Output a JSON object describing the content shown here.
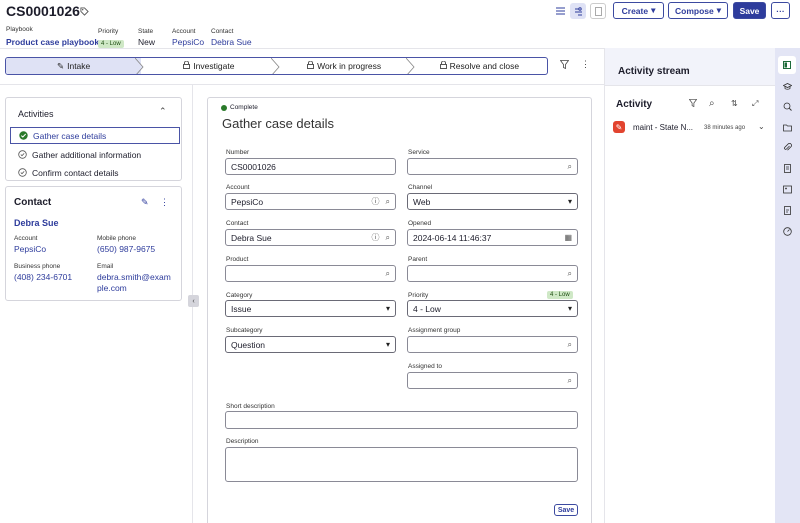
{
  "header": {
    "case_number": "CS0001026",
    "playbook_label": "Playbook",
    "playbook_value": "Product case playbook",
    "priority_label": "Priority",
    "priority_value": "4 - Low",
    "state_label": "State",
    "state_value": "New",
    "account_label": "Account",
    "account_value": "PepsiCo",
    "contact_label": "Contact",
    "contact_value": "Debra Sue",
    "create_label": "Create",
    "compose_label": "Compose",
    "save_label": "Save",
    "more_label": "···"
  },
  "stepper": {
    "steps": [
      {
        "label": "Intake",
        "icon": "pencil-icon"
      },
      {
        "label": "Investigate",
        "icon": "lock-icon"
      },
      {
        "label": "Work in progress",
        "icon": "lock-icon"
      },
      {
        "label": "Resolve and close",
        "icon": "lock-icon"
      }
    ]
  },
  "activities": {
    "title": "Activities",
    "items": [
      {
        "label": "Gather case details",
        "status": "complete"
      },
      {
        "label": "Gather additional information",
        "status": "pending"
      },
      {
        "label": "Confirm contact details",
        "status": "pending"
      }
    ]
  },
  "contact_card": {
    "title": "Contact",
    "name": "Debra Sue",
    "account_label": "Account",
    "account_value": "PepsiCo",
    "mobile_label": "Mobile phone",
    "mobile_value": "(650) 987-9675",
    "business_label": "Business phone",
    "business_value": "(408) 234-6701",
    "email_label": "Email",
    "email_line1": "debra.smith@exam",
    "email_line2": "ple.com"
  },
  "form": {
    "status": "Complete",
    "title": "Gather case details",
    "number_label": "Number",
    "number_value": "CS0001026",
    "service_label": "Service",
    "account_label": "Account",
    "account_value": "PepsiCo",
    "channel_label": "Channel",
    "channel_value": "Web",
    "contact_label": "Contact",
    "contact_value": "Debra Sue",
    "opened_label": "Opened",
    "opened_value": "2024-06-14 11:46:37",
    "product_label": "Product",
    "parent_label": "Parent",
    "category_label": "Category",
    "category_value": "Issue",
    "priority_label": "Priority",
    "priority_badge": "4 - Low",
    "priority_value": "4 - Low",
    "subcategory_label": "Subcategory",
    "subcategory_value": "Question",
    "assignment_group_label": "Assignment group",
    "assigned_to_label": "Assigned to",
    "short_description_label": "Short description",
    "description_label": "Description",
    "save_label": "Save"
  },
  "activity_stream": {
    "title": "Activity stream",
    "subtitle": "Activity",
    "entry_text": "maint - State N...",
    "entry_time": "38 minutes ago"
  },
  "colors": {
    "brand": "#2e3c9c",
    "complete_green": "#2a7a2a",
    "badge_green": "#cfe8c6",
    "rail_bg": "#e3e5f5",
    "stream_header_bg": "#f2f3fa",
    "entry_icon_bg": "#e2442f"
  }
}
